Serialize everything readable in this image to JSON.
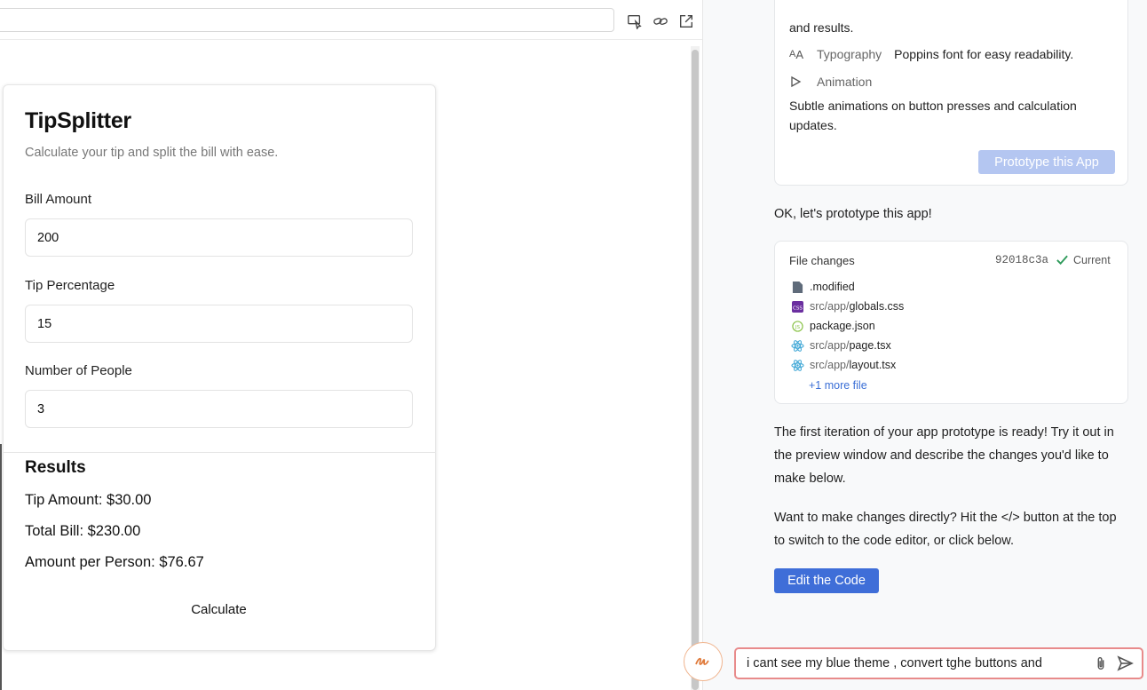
{
  "preview": {
    "url": ""
  },
  "app": {
    "title": "TipSplitter",
    "subtitle": "Calculate your tip and split the bill with ease.",
    "fields": [
      {
        "label": "Bill Amount",
        "value": "200"
      },
      {
        "label": "Tip Percentage",
        "value": "15"
      },
      {
        "label": "Number of People",
        "value": "3"
      }
    ],
    "results_title": "Results",
    "results": [
      "Tip Amount: $30.00",
      "Total Bill: $230.00",
      "Amount per Person: $76.67"
    ],
    "calculate_label": "Calculate"
  },
  "chat": {
    "blueprint": {
      "text_top": "and results.",
      "typography_label": "Typography",
      "typography_value": "Poppins font for easy readability.",
      "animation_label": "Animation",
      "animation_value": "Subtle animations on button presses and calculation updates.",
      "prototype_button": "Prototype this App"
    },
    "msg_prototype": "OK, let's prototype this app!",
    "file_changes": {
      "title": "File changes",
      "commit": "92018c3a",
      "status": "Current",
      "files": [
        {
          "path": "",
          "name": ".modified",
          "icon": "file-icon",
          "color": "#5f6b7a"
        },
        {
          "path": "src/app/",
          "name": "globals.css",
          "icon": "css-icon",
          "color": "#6b2fa0"
        },
        {
          "path": "",
          "name": "package.json",
          "icon": "json-icon",
          "color": "#8bc34a"
        },
        {
          "path": "src/app/",
          "name": "page.tsx",
          "icon": "react-icon",
          "color": "#3fa7d6"
        },
        {
          "path": "src/app/",
          "name": "layout.tsx",
          "icon": "react-icon",
          "color": "#3fa7d6"
        }
      ],
      "more": "+1 more file"
    },
    "msg_ready": "The first iteration of your app prototype is ready! Try it out in the preview window and describe the changes you'd like to make below.",
    "msg_edit": "Want to make changes directly? Hit the </> button at the top to switch to the code editor, or click below.",
    "edit_button": "Edit the Code",
    "input_value": "i cant see my blue theme , convert tghe buttons and"
  },
  "colors": {
    "accent": "#3f6ed8",
    "accent_disabled": "#b4c6f1",
    "input_border": "#e88b8b",
    "success": "#2e9a5a"
  }
}
